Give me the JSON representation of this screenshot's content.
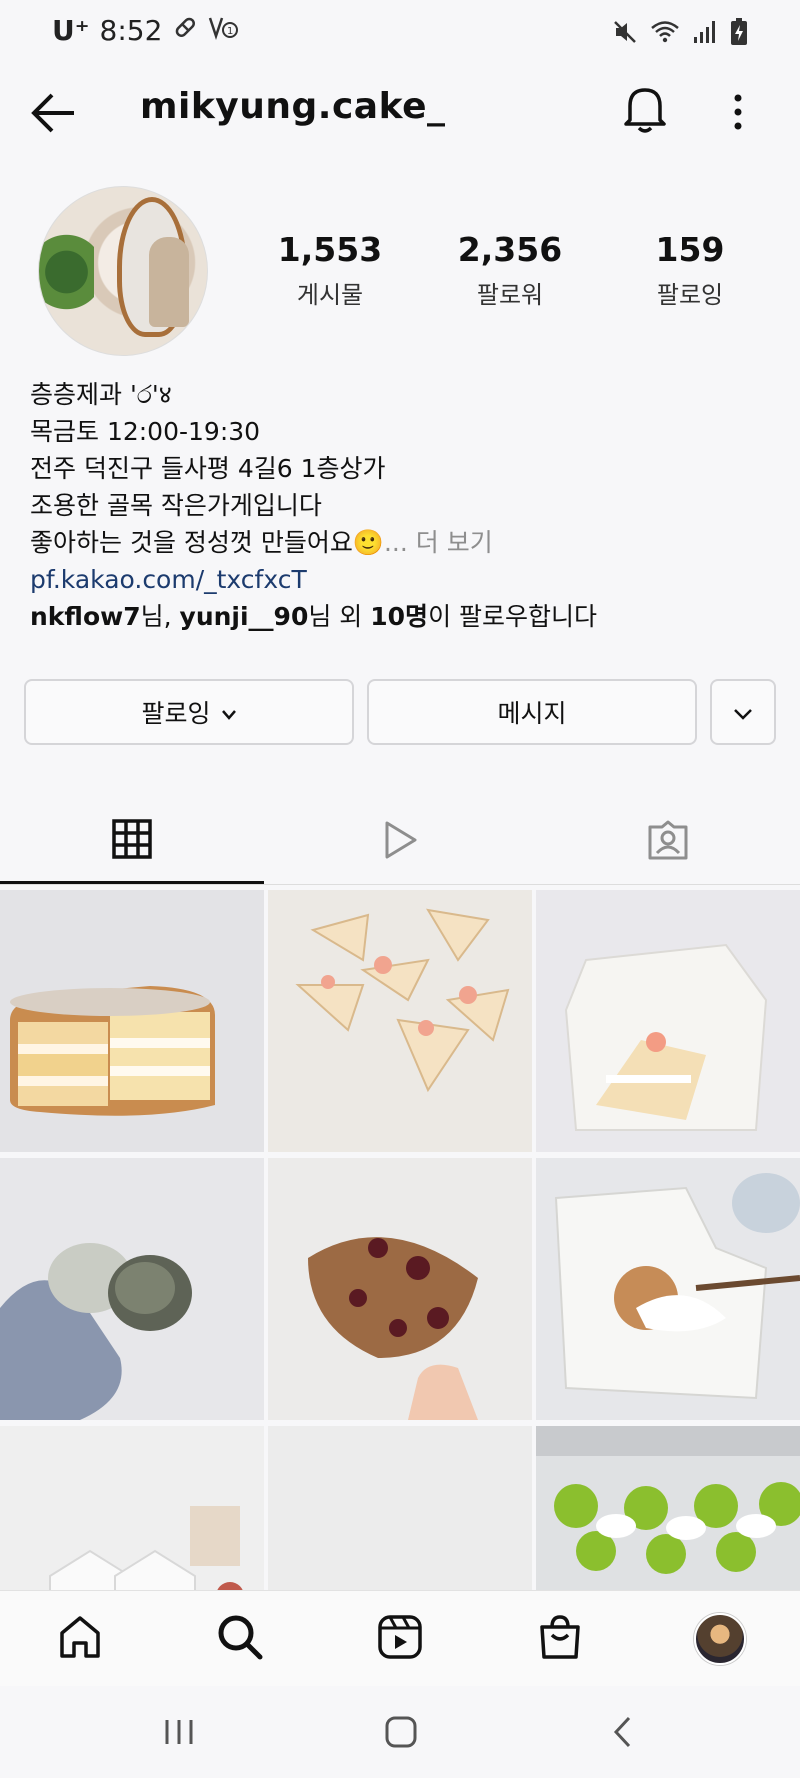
{
  "status_bar": {
    "carrier": "U⁺",
    "time": "8:52"
  },
  "header": {
    "username": "mikyung.cake_"
  },
  "profile": {
    "stats": [
      {
        "value": "1,553",
        "label": "게시물"
      },
      {
        "value": "2,356",
        "label": "팔로워"
      },
      {
        "value": "159",
        "label": "팔로잉"
      }
    ],
    "bio": {
      "line1": "층층제과 'ර'४",
      "line2": "목금토 12:00-19:30",
      "line3": "전주 덕진구 들사평 4길6 1층상가",
      "line4": "조용한 골목 작은가게입니다",
      "line5": "좋아하는 것을 정성껏 만들어요🙂",
      "more": "... 더 보기",
      "link": "pf.kakao.com/_txcfxcT",
      "followed_user1": "nkflow7",
      "followed_sep1": "님, ",
      "followed_user2": "yunji__90",
      "followed_sep2": "님 외 ",
      "followed_count": "10명",
      "followed_tail": "이 팔로우합니다"
    }
  },
  "actions": {
    "follow_label": "팔로잉",
    "message_label": "메시지"
  },
  "tabs": [
    {
      "icon": "grid-icon",
      "active": true
    },
    {
      "icon": "reels-icon",
      "active": false
    },
    {
      "icon": "tagged-icon",
      "active": false
    }
  ],
  "bottom_nav": [
    "home-icon",
    "search-icon",
    "reels-icon",
    "shop-icon",
    "profile-avatar"
  ],
  "colors": {
    "link": "#1c3b6e",
    "muted": "#8e8e8e",
    "border": "#d5d5d8"
  }
}
